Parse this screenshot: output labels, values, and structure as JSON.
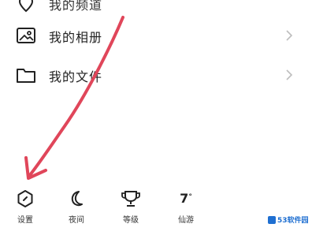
{
  "menu": {
    "partial_item": {
      "label": "我的频道",
      "icon": "location-pin-icon"
    },
    "items": [
      {
        "label": "我的相册",
        "icon": "photo-album-icon"
      },
      {
        "label": "我的文件",
        "icon": "folder-icon"
      }
    ]
  },
  "bottom_bar": {
    "items": [
      {
        "label": "设置",
        "icon": "settings-hexagon-icon"
      },
      {
        "label": "夜间",
        "icon": "moon-icon"
      },
      {
        "label": "等级",
        "icon": "trophy-cup-icon"
      },
      {
        "label": "仙游",
        "icon": "temperature-display",
        "value": "7",
        "unit": "°"
      }
    ]
  },
  "annotation": {
    "color": "#e0465a",
    "icon": "red-arrow-pointing-to-settings"
  },
  "watermark": {
    "text": "53软件园",
    "color": "#1f6fd1"
  }
}
